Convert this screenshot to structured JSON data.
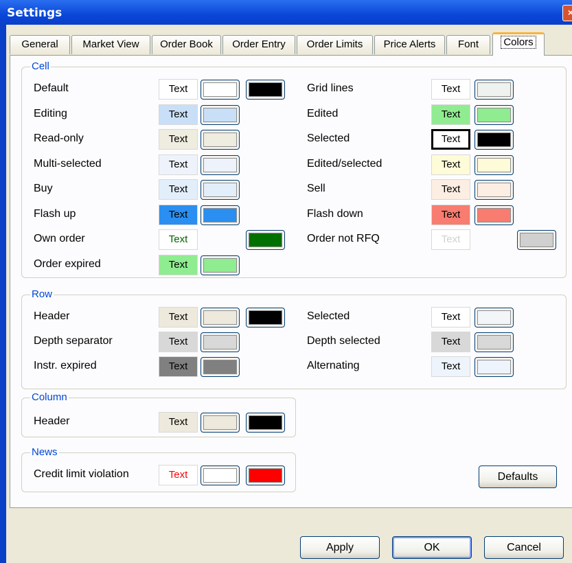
{
  "window": {
    "title": "Settings",
    "close_glyph": "×"
  },
  "tabs": [
    "General",
    "Market View",
    "Order Book",
    "Order Entry",
    "Order Limits",
    "Price Alerts",
    "Font",
    "Colors"
  ],
  "active_tab": "Colors",
  "sample_text": "Text",
  "groups": {
    "cell": {
      "legend": "Cell",
      "left": [
        {
          "label": "Default",
          "fg": "#000000",
          "bg": "#ffffff",
          "bg_btn": "#ffffff",
          "fg_btn": "#000000"
        },
        {
          "label": "Editing",
          "fg": "#000000",
          "bg": "#c9dff8",
          "bg_btn": "#c9dff8"
        },
        {
          "label": "Read-only",
          "fg": "#000000",
          "bg": "#efece0",
          "bg_btn": "#efece0"
        },
        {
          "label": "Multi-selected",
          "fg": "#000000",
          "bg": "#eef3fb",
          "bg_btn": "#eef3fb"
        },
        {
          "label": "Buy",
          "fg": "#000000",
          "bg": "#e3eefb",
          "bg_btn": "#e3eefb"
        },
        {
          "label": "Flash up",
          "fg": "#000000",
          "bg": "#2a8ff0",
          "bg_btn": "#2a8ff0"
        },
        {
          "label": "Own order",
          "fg": "#006400",
          "bg": "#ffffff",
          "fg_btn": "#007000"
        },
        {
          "label": "Order expired",
          "fg": "#000000",
          "bg": "#90ec90",
          "bg_btn": "#90ec90"
        }
      ],
      "right": [
        {
          "label": "Grid lines",
          "fg": "#000000",
          "bg": "#ffffff",
          "bg_btn": "#eff3ef"
        },
        {
          "label": "Edited",
          "fg": "#000000",
          "bg": "#90ec90",
          "bg_btn": "#90ec90"
        },
        {
          "label": "Selected",
          "fg": "#000000",
          "bg": "#ffffff",
          "bg_btn": "#000000",
          "boxed": true
        },
        {
          "label": "Edited/selected",
          "fg": "#000000",
          "bg": "#fefbd8",
          "bg_btn": "#fefbd8"
        },
        {
          "label": "Sell",
          "fg": "#000000",
          "bg": "#fdeee4",
          "bg_btn": "#fdeee4"
        },
        {
          "label": "Flash down",
          "fg": "#000000",
          "bg": "#f87c70",
          "bg_btn": "#f87c70"
        },
        {
          "label": "Order not RFQ",
          "fg": "#d0d0d0",
          "bg": "#ffffff",
          "fg_btn": "#d0d0d0"
        }
      ]
    },
    "row": {
      "legend": "Row",
      "left": [
        {
          "label": "Header",
          "fg": "#000000",
          "bg": "#ede9dc",
          "bg_btn": "#ede9dc",
          "fg_btn": "#000000"
        },
        {
          "label": "Depth separator",
          "fg": "#000000",
          "bg": "#d8d8d8",
          "bg_btn": "#d8d8d8"
        },
        {
          "label": "Instr. expired",
          "fg": "#000000",
          "bg": "#808080",
          "bg_btn": "#808080"
        }
      ],
      "right": [
        {
          "label": "Selected",
          "fg": "#000000",
          "bg": "#ffffff",
          "bg_btn": "#f2f6f8"
        },
        {
          "label": "Depth selected",
          "fg": "#000000",
          "bg": "#d8d8d8",
          "bg_btn": "#d8d8d8"
        },
        {
          "label": "Alternating",
          "fg": "#000000",
          "bg": "#eef4fb",
          "bg_btn": "#eef4fb"
        }
      ]
    },
    "column": {
      "legend": "Column",
      "left": [
        {
          "label": "Header",
          "fg": "#000000",
          "bg": "#ede9dc",
          "bg_btn": "#ede9dc",
          "fg_btn": "#000000"
        }
      ]
    },
    "news": {
      "legend": "News",
      "left": [
        {
          "label": "Credit limit violation",
          "fg": "#ff0000",
          "bg": "#ffffff",
          "bg_btn": "#ffffff",
          "fg_btn": "#ff0000"
        }
      ]
    }
  },
  "buttons": {
    "defaults": "Defaults",
    "apply": "Apply",
    "ok": "OK",
    "cancel": "Cancel"
  }
}
